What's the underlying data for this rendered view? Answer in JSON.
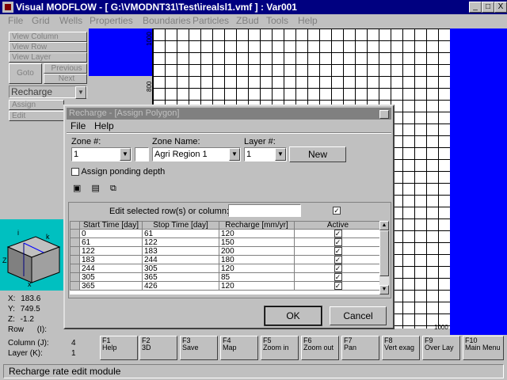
{
  "window": {
    "title": "Visual MODFLOW - [ G:\\VMODNT31\\Test\\irealsl1.vmf ] : Var001",
    "buttons": [
      "_",
      "□",
      "X"
    ]
  },
  "menu": [
    "File",
    "Grid",
    "Wells",
    "Properties",
    "Boundaries",
    "Particles",
    "ZBud",
    "Tools",
    "Help"
  ],
  "left_panel": {
    "view_column": "View Column",
    "view_row": "View Row",
    "view_layer": "View Layer",
    "goto": "Goto",
    "previous": "Previous",
    "next": "Next",
    "boundary_select": "Recharge",
    "assign": "Assign",
    "edit": "Edit"
  },
  "axis_labels": {
    "y_top": "1000",
    "y_mid": "800",
    "x_end": "1000"
  },
  "coords": {
    "x_label": "X:",
    "x_value": "183.6",
    "y_label": "Y:",
    "y_value": "749.5",
    "z_label": "Z:",
    "z_value": "-1.2",
    "row_label": "Row",
    "row_key": "(I):",
    "col_label": "Column (J):",
    "col_value": "4",
    "layer_label": "Layer (K):",
    "layer_value": "1"
  },
  "dialog": {
    "title": "Recharge - [Assign Polygon]",
    "close": "x",
    "menu": [
      "File",
      "Help"
    ],
    "zone_label": "Zone #:",
    "zone_value": "1",
    "zone_name_label": "Zone Name:",
    "zone_name_value": "Agri Region 1",
    "layer_label": "Layer #:",
    "layer_value": "1",
    "new_button": "New",
    "ponding_label": "Assign ponding depth",
    "edit_selected_label": "Edit selected row(s) or column:",
    "table": {
      "headers": [
        "Start Time [day]",
        "Stop Time [day]",
        "Recharge [mm/yr]",
        "Active"
      ],
      "rows": [
        [
          "0",
          "61",
          "120",
          "✓"
        ],
        [
          "61",
          "122",
          "150",
          "✓"
        ],
        [
          "122",
          "183",
          "200",
          "✓"
        ],
        [
          "183",
          "244",
          "180",
          "✓"
        ],
        [
          "244",
          "305",
          "120",
          "✓"
        ],
        [
          "305",
          "365",
          "85",
          "✓"
        ],
        [
          "365",
          "426",
          "120",
          "✓"
        ]
      ]
    },
    "ok": "OK",
    "cancel": "Cancel"
  },
  "fkeys": [
    {
      "key": "F1",
      "label": "Help"
    },
    {
      "key": "F2",
      "label": "3D"
    },
    {
      "key": "F3",
      "label": "Save"
    },
    {
      "key": "F4",
      "label": "Map"
    },
    {
      "key": "F5",
      "label": "Zoom in"
    },
    {
      "key": "F6",
      "label": "Zoom out"
    },
    {
      "key": "F7",
      "label": "Pan"
    },
    {
      "key": "F8",
      "label": "Vert exag"
    },
    {
      "key": "F9",
      "label": "Over Lay"
    },
    {
      "key": "F10",
      "label": "Main Menu"
    }
  ],
  "status": "Recharge rate edit module"
}
